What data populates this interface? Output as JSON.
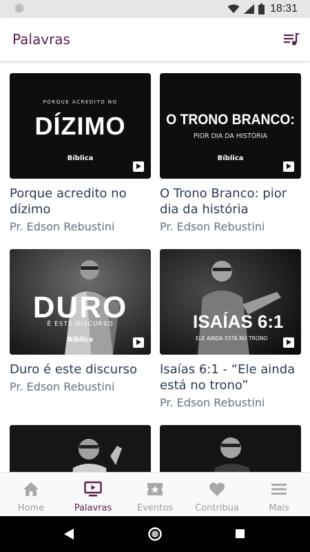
{
  "status_bar": {
    "time": "18:31"
  },
  "app_bar": {
    "title": "Palavras",
    "action_icon": "playlist-icon"
  },
  "accent_color": "#5a1f4c",
  "videos": [
    {
      "thumb_top": "PORQUE ACREDITO NO",
      "thumb_main": "DÍZIMO",
      "thumb_sub": "",
      "logo": "Bíblica",
      "title": "Porque acredito no dízimo",
      "author": "Pr. Edson Rebustini"
    },
    {
      "thumb_top": "",
      "thumb_main": "O TRONO BRANCO:",
      "thumb_sub": "PIOR DIA DA HISTÓRIA",
      "logo": "Bíblica",
      "title": "O Trono Branco: pior dia da história",
      "author": "Pr. Edson Rebustini"
    },
    {
      "thumb_top": "",
      "thumb_main": "DURO",
      "thumb_sub": "É ESTE DISCURSO",
      "logo": "Bíblica",
      "title": "Duro é este discurso",
      "author": "Pr. Edson Rebustini"
    },
    {
      "thumb_top": "",
      "thumb_main": "ISAÍAS 6:1",
      "thumb_sub": "ELE AINDA ESTÁ NO TRONO",
      "logo": "",
      "title": "Isaías 6:1 - “Ele ainda está no trono”",
      "author": "Pr. Edson Rebustini"
    }
  ],
  "bottom_nav": [
    {
      "label": "Home",
      "icon": "home-icon",
      "active": false
    },
    {
      "label": "Palavras",
      "icon": "tv-play-icon",
      "active": true
    },
    {
      "label": "Eventos",
      "icon": "ticket-star-icon",
      "active": false
    },
    {
      "label": "Contribua",
      "icon": "heart-icon",
      "active": false
    },
    {
      "label": "Mais",
      "icon": "menu-icon",
      "active": false
    }
  ],
  "system_nav": {
    "back_icon": "back-triangle-icon",
    "home_icon": "home-circle-icon",
    "recents_icon": "recents-square-icon"
  }
}
